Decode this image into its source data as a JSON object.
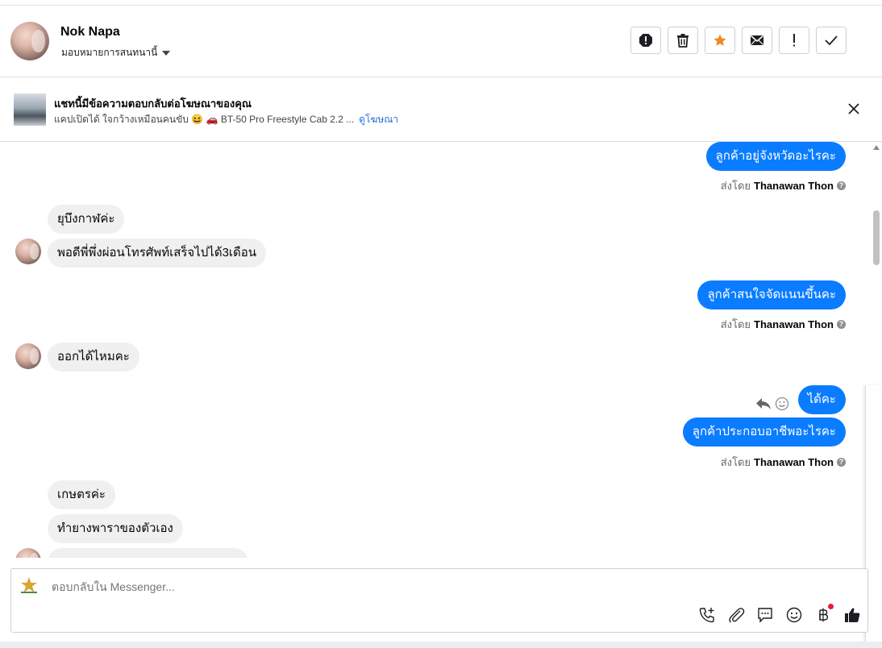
{
  "header": {
    "name": "Nok Napa",
    "assign_label": "มอบหมายการสนทนานี้"
  },
  "ad_banner": {
    "title": "แชทนี้มีข้อความตอบกลับต่อโฆษณาของคุณ",
    "subtitle": "แคปเปิดได้ ใจกว้างเหมือนคนขับ 😆 🚗 BT-50 Pro Freestyle Cab 2.2 ...",
    "link": "ดูโฆษณา"
  },
  "messages": {
    "out1": "ลูกค้าอยู่จังหวัดอะไรคะ",
    "sent1_prefix": "ส่งโดย",
    "sent1_name": "Thanawan Thon",
    "in1": "ยุบึงกาฬค่ะ",
    "in2": "พอดีพี่พึ่งผ่อนโทรศัพท์เสร็จไปได้3เดือน",
    "out2": "ลูกค้าสนใจจัดแนนขึ้นคะ",
    "sent2_prefix": "ส่งโดย",
    "sent2_name": "Thanawan Thon",
    "in3": "ออกได้ไหมคะ",
    "out3": "ได้คะ",
    "out4": "ลูกค้าประกอบอาชีพอะไรคะ",
    "sent3_prefix": "ส่งโดย",
    "sent3_name": "Thanawan Thon",
    "in4": "เกษตรค่ะ",
    "in5": "ทำยางพาราของตัวเอง"
  },
  "reply": {
    "placeholder": "ตอบกลับใน Messenger..."
  },
  "colors": {
    "accent": "#0a7cff",
    "incoming": "#f0f0f0",
    "link": "#216fdb"
  },
  "icons": {
    "actions": [
      "alert-icon",
      "trash-icon",
      "star-icon",
      "envelope-icon",
      "exclamation-icon",
      "check-icon"
    ],
    "tools": [
      "phone-add-icon",
      "paperclip-icon",
      "saved-reply-icon",
      "emoji-icon",
      "baht-icon",
      "thumbs-up-icon"
    ]
  }
}
